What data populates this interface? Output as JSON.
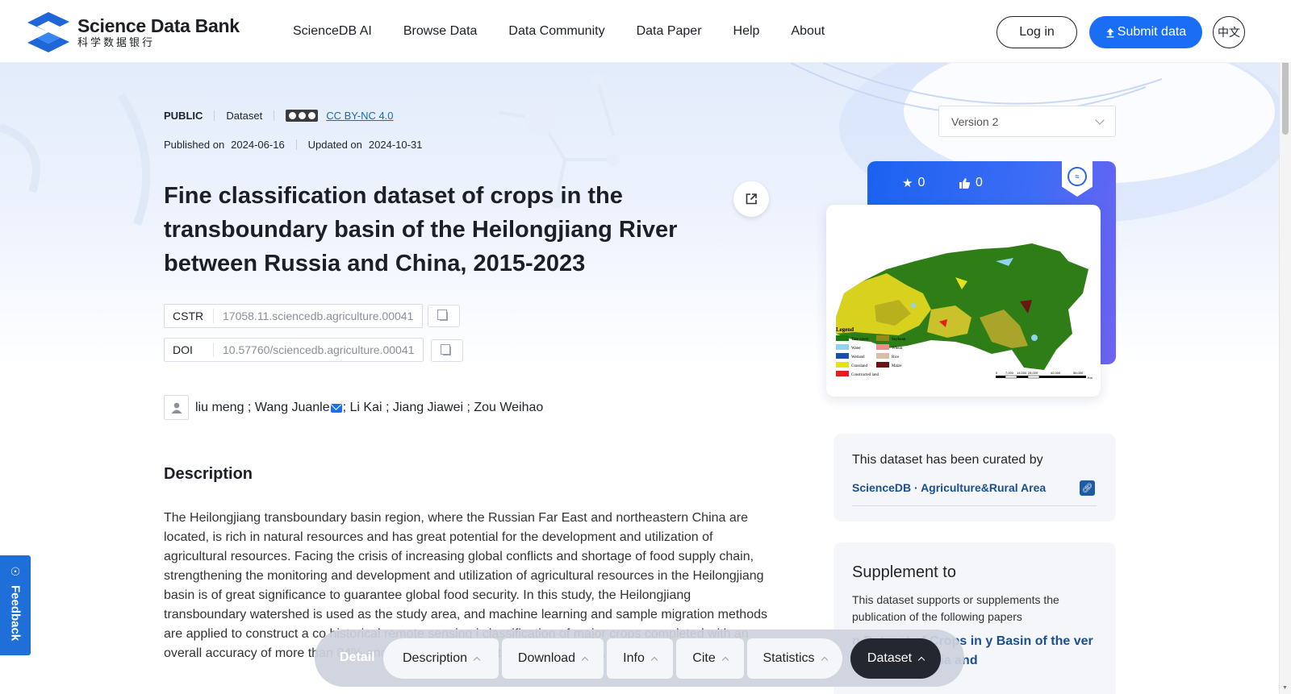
{
  "header": {
    "logo_en": "Science Data Bank",
    "logo_cn": "科学数据银行",
    "nav": [
      "ScienceDB AI",
      "Browse Data",
      "Data Community",
      "Data Paper",
      "Help",
      "About"
    ],
    "login_label": "Log in",
    "submit_label": "Submit data",
    "lang_label": "中文"
  },
  "meta": {
    "access": "PUBLIC",
    "type": "Dataset",
    "license": "CC BY-NC 4.0",
    "published_label": "Published on",
    "published_date": "2024-06-16",
    "updated_label": "Updated on",
    "updated_date": "2024-10-31"
  },
  "version": {
    "selected": "Version 2"
  },
  "title": "Fine classification dataset of crops in the transboundary basin of the Heilongjiang River between Russia and China, 2015-2023",
  "identifiers": {
    "cstr_label": "CSTR",
    "cstr_value": "17058.11.sciencedb.agriculture.00041",
    "doi_label": "DOI",
    "doi_value": "10.57760/sciencedb.agriculture.00041"
  },
  "authors": {
    "before_mail": "liu meng ; Wang Juanle",
    "after_mail": "; Li Kai ; Jiang Jiawei ; Zou Weihao"
  },
  "description": {
    "heading": "Description",
    "text": "The Heilongjiang transboundary basin region, where the Russian Far East and northeastern China are located, is rich in natural resources and has great potential for the development and utilization of agricultural resources. Facing the crisis of increasing global conflicts and shortage of food supply chain, strengthening the monitoring and development and utilization of agricultural resources in the Heilongjiang basin is of great significance to guarantee global food security. In this study, the Heilongjiang transboundary watershed is used as the study area, and machine learning and sample migration methods are applied to construct a co historical remote sensing i classification of major crops completed with an overall accuracy of more than 84% and a Kappa coefficient of more than 0.81, using"
  },
  "stats": {
    "stars": "0",
    "likes": "0"
  },
  "map_legend": {
    "title": "Legend",
    "items": [
      "Tree cover",
      "Water",
      "Wetland",
      "Grassland",
      "Constructed land",
      "Soybean",
      "Wheat",
      "Rice",
      "Maize"
    ],
    "colors": [
      "#1a7a12",
      "#8fd3f0",
      "#1a4fa8",
      "#e6e21a",
      "#e81c1c",
      "#8f8a1a",
      "#f08c8c",
      "#d8c0a8",
      "#6b1414"
    ],
    "scale_ticks": [
      "0",
      "7,000",
      "14,000",
      "28,000",
      "42,000",
      "56,000"
    ],
    "scale_unit": "Km"
  },
  "curated": {
    "text": "This dataset has been curated by",
    "link": "ScienceDB · Agriculture&Rural Area"
  },
  "supplement": {
    "heading": "Supplement to",
    "text": "This dataset supports or supplements the publication of the following papers",
    "paper_title": "n Dataset of Crops in y Basin of the ver Between Russia and"
  },
  "feedback_label": "Feedback",
  "bottom_bar": {
    "label": "Detail",
    "tabs": [
      "Description",
      "Download",
      "Info",
      "Cite",
      "Statistics",
      "Dataset"
    ],
    "active": "Dataset"
  },
  "colors": {
    "primary": "#1a6ef5",
    "link": "#1b4f8f",
    "active_tab": "#23272f"
  }
}
